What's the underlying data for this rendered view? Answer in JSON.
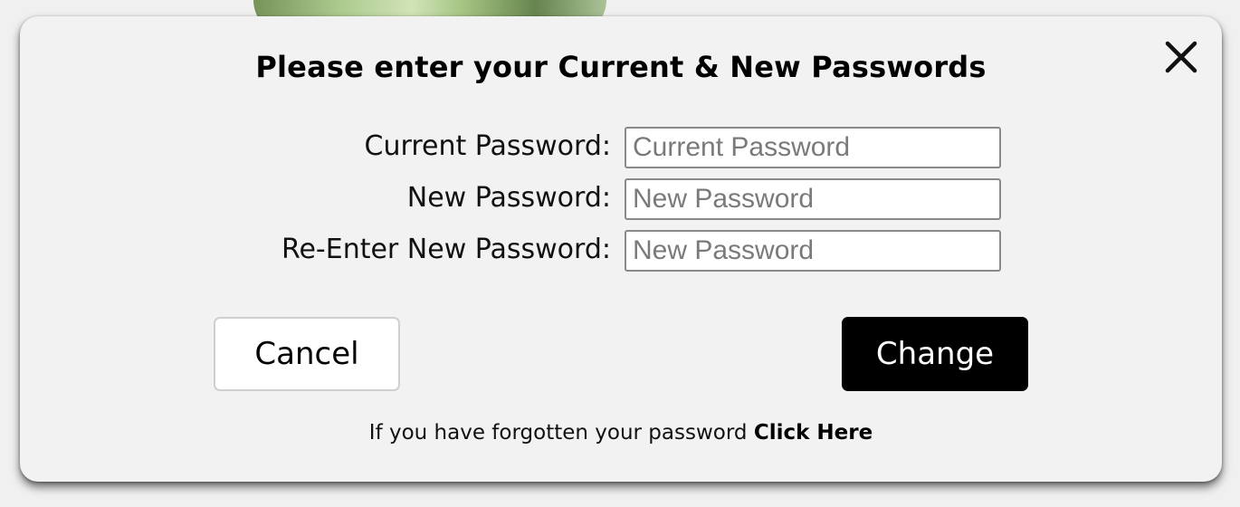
{
  "dialog": {
    "title": "Please enter your Current & New Passwords",
    "close_icon": "close-icon"
  },
  "form": {
    "fields": [
      {
        "label": "Current Password:",
        "placeholder": "Current Password",
        "value": ""
      },
      {
        "label": "New Password:",
        "placeholder": "New Password",
        "value": ""
      },
      {
        "label": "Re-Enter New Password:",
        "placeholder": "New Password",
        "value": ""
      }
    ]
  },
  "buttons": {
    "cancel_label": "Cancel",
    "change_label": "Change"
  },
  "footer": {
    "forgot_text": "If you have forgotten your password",
    "forgot_link": "Click Here"
  },
  "colors": {
    "dialog_bg": "#f2f2f2",
    "primary_button_bg": "#000000",
    "primary_button_text": "#ffffff"
  }
}
